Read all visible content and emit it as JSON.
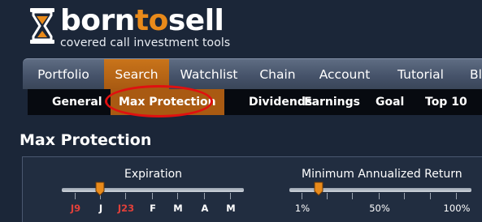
{
  "brand": {
    "name_prefix": "born",
    "name_accent": "to",
    "name_suffix": "sell",
    "tagline": "covered call investment tools"
  },
  "main_nav": [
    {
      "label": "Portfolio",
      "active": false
    },
    {
      "label": "Search",
      "active": true
    },
    {
      "label": "Watchlist",
      "active": false
    },
    {
      "label": "Chain",
      "active": false
    },
    {
      "label": "Account",
      "active": false
    },
    {
      "label": "Tutorial",
      "active": false
    },
    {
      "label": "Bl",
      "active": false
    }
  ],
  "sub_nav": [
    {
      "label": "General",
      "active": false
    },
    {
      "label": "Max Protection",
      "active": true
    },
    {
      "label": "Dividends",
      "active": false
    },
    {
      "label": "Earnings",
      "active": false
    },
    {
      "label": "Goal",
      "active": false
    },
    {
      "label": "Top 10",
      "active": false
    }
  ],
  "page_title": "Max Protection",
  "expiration_slider": {
    "label": "Expiration",
    "ticks": [
      "J9",
      "J",
      "J23",
      "F",
      "M",
      "A",
      "M"
    ],
    "red_ticks": [
      "J9",
      "J23"
    ],
    "selected_index": 1
  },
  "return_slider": {
    "label": "Minimum Annualized Return",
    "tick_labels": [
      "1%",
      "50%",
      "100%"
    ],
    "selected": "1%"
  },
  "colors": {
    "background": "#1b2638",
    "accent": "#e98a1a",
    "active_tab": "#a95a12",
    "highlight_ring": "#e01010",
    "red_tick": "#e0403a"
  }
}
